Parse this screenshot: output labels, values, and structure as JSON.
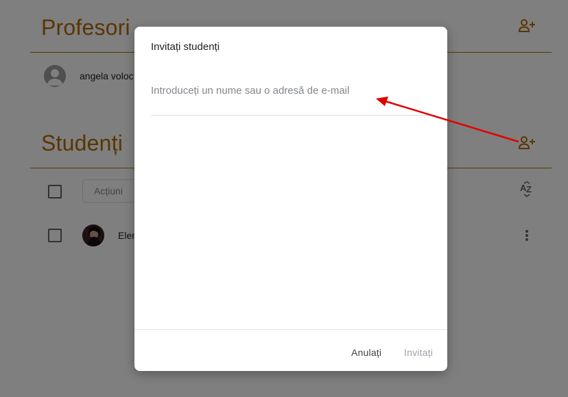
{
  "colors": {
    "accent": "#b36b00",
    "scrim": "rgba(0,0,0,0.5)",
    "annotation_arrow": "#e00000"
  },
  "teachers_section": {
    "title": "Profesori",
    "add_icon": "person-add-icon",
    "teacher_name": "angela voloc"
  },
  "students_section": {
    "title": "Studenți",
    "add_icon": "person-add-icon",
    "actions_label": "Acțiuni",
    "sort_icon": "sort-az-icon",
    "student_name": "Elen",
    "more_icon": "more-vert-icon"
  },
  "dialog": {
    "title": "Invitați studenți",
    "input_placeholder": "Introduceți un nume sau o adresă de e-mail",
    "input_value": "",
    "cancel_label": "Anulați",
    "invite_label": "Invitați"
  }
}
